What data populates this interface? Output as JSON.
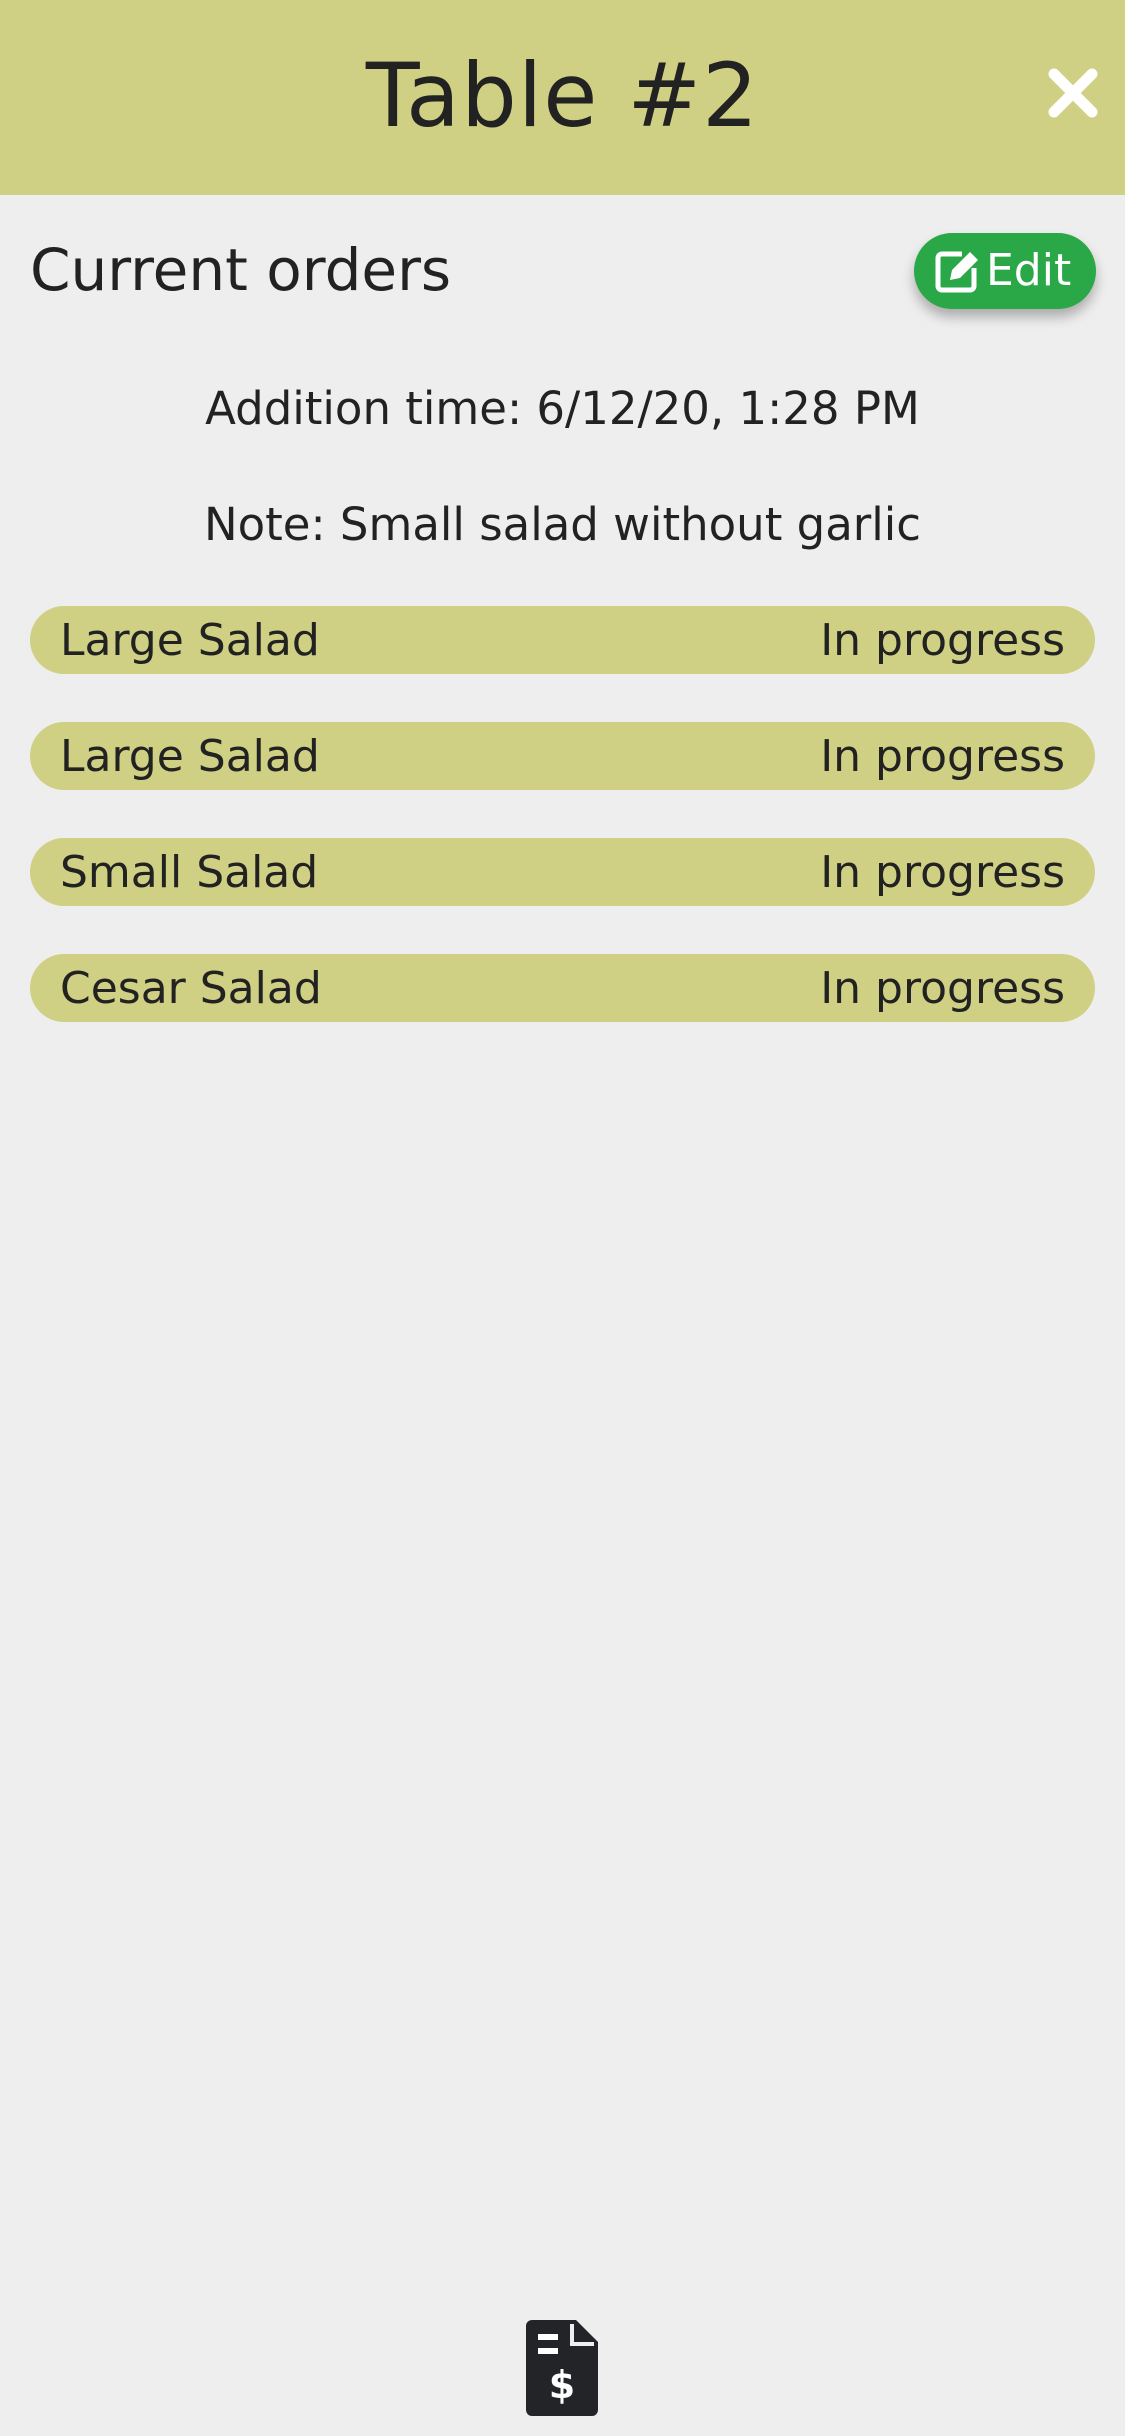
{
  "header": {
    "title": "Table #2",
    "close_icon": "close-icon",
    "background_color": "#cfd083"
  },
  "section": {
    "title": "Current orders",
    "edit_label": "Edit",
    "edit_icon": "edit-icon",
    "edit_color": "#2aa747"
  },
  "info": {
    "addition_time": "Addition time: 6/12/20, 1:28 PM",
    "note": "Note: Small salad without garlic"
  },
  "orders": [
    {
      "name": "Large Salad",
      "status": "In progress"
    },
    {
      "name": "Large Salad",
      "status": "In progress"
    },
    {
      "name": "Small Salad",
      "status": "In progress"
    },
    {
      "name": "Cesar Salad",
      "status": "In progress"
    }
  ],
  "footer": {
    "bill_icon": "invoice-dollar-icon"
  }
}
